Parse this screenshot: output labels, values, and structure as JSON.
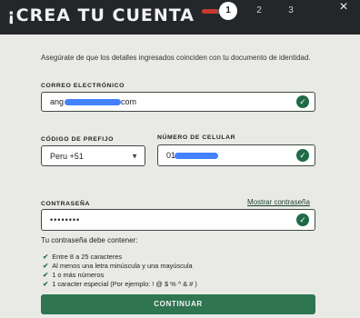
{
  "header": {
    "title": "¡CREA TU CUENTA",
    "steps": [
      "1",
      "2",
      "3"
    ],
    "progress_fraction": 0.65,
    "close": "×"
  },
  "form": {
    "info": "Asegúrate de que los detalles ingresados coinciden con tu documento de identidad.",
    "email": {
      "label": "CORREO ELECTRÓNICO",
      "value_start": "ang",
      "value_end": "com"
    },
    "prefix": {
      "label": "CÓDIGO DE PREFIJO",
      "value": "Peru +51"
    },
    "phone": {
      "label": "NÚMERO DE CELULAR",
      "value": "01"
    },
    "password": {
      "label": "CONTRASEÑA",
      "show_link": "Mostrar contraseña",
      "value": "••••••••"
    },
    "requirements_title": "Tu contraseña debe contener:",
    "requirements": [
      "Entre 8 a 25 caracteres",
      "Al menos una letra minúscula y una mayúscula",
      "1 o más números",
      "1 caracter especial (Por ejemplo: ! @ $ % ^ & # )"
    ],
    "submit": "CONTINUAR"
  },
  "colors": {
    "header": "#24272a",
    "accent": "#2e7550",
    "progress": "#c9392c"
  },
  "icons": {
    "valid": "check-circle-icon",
    "close": "close-icon",
    "dropdown": "caret-down-icon"
  }
}
